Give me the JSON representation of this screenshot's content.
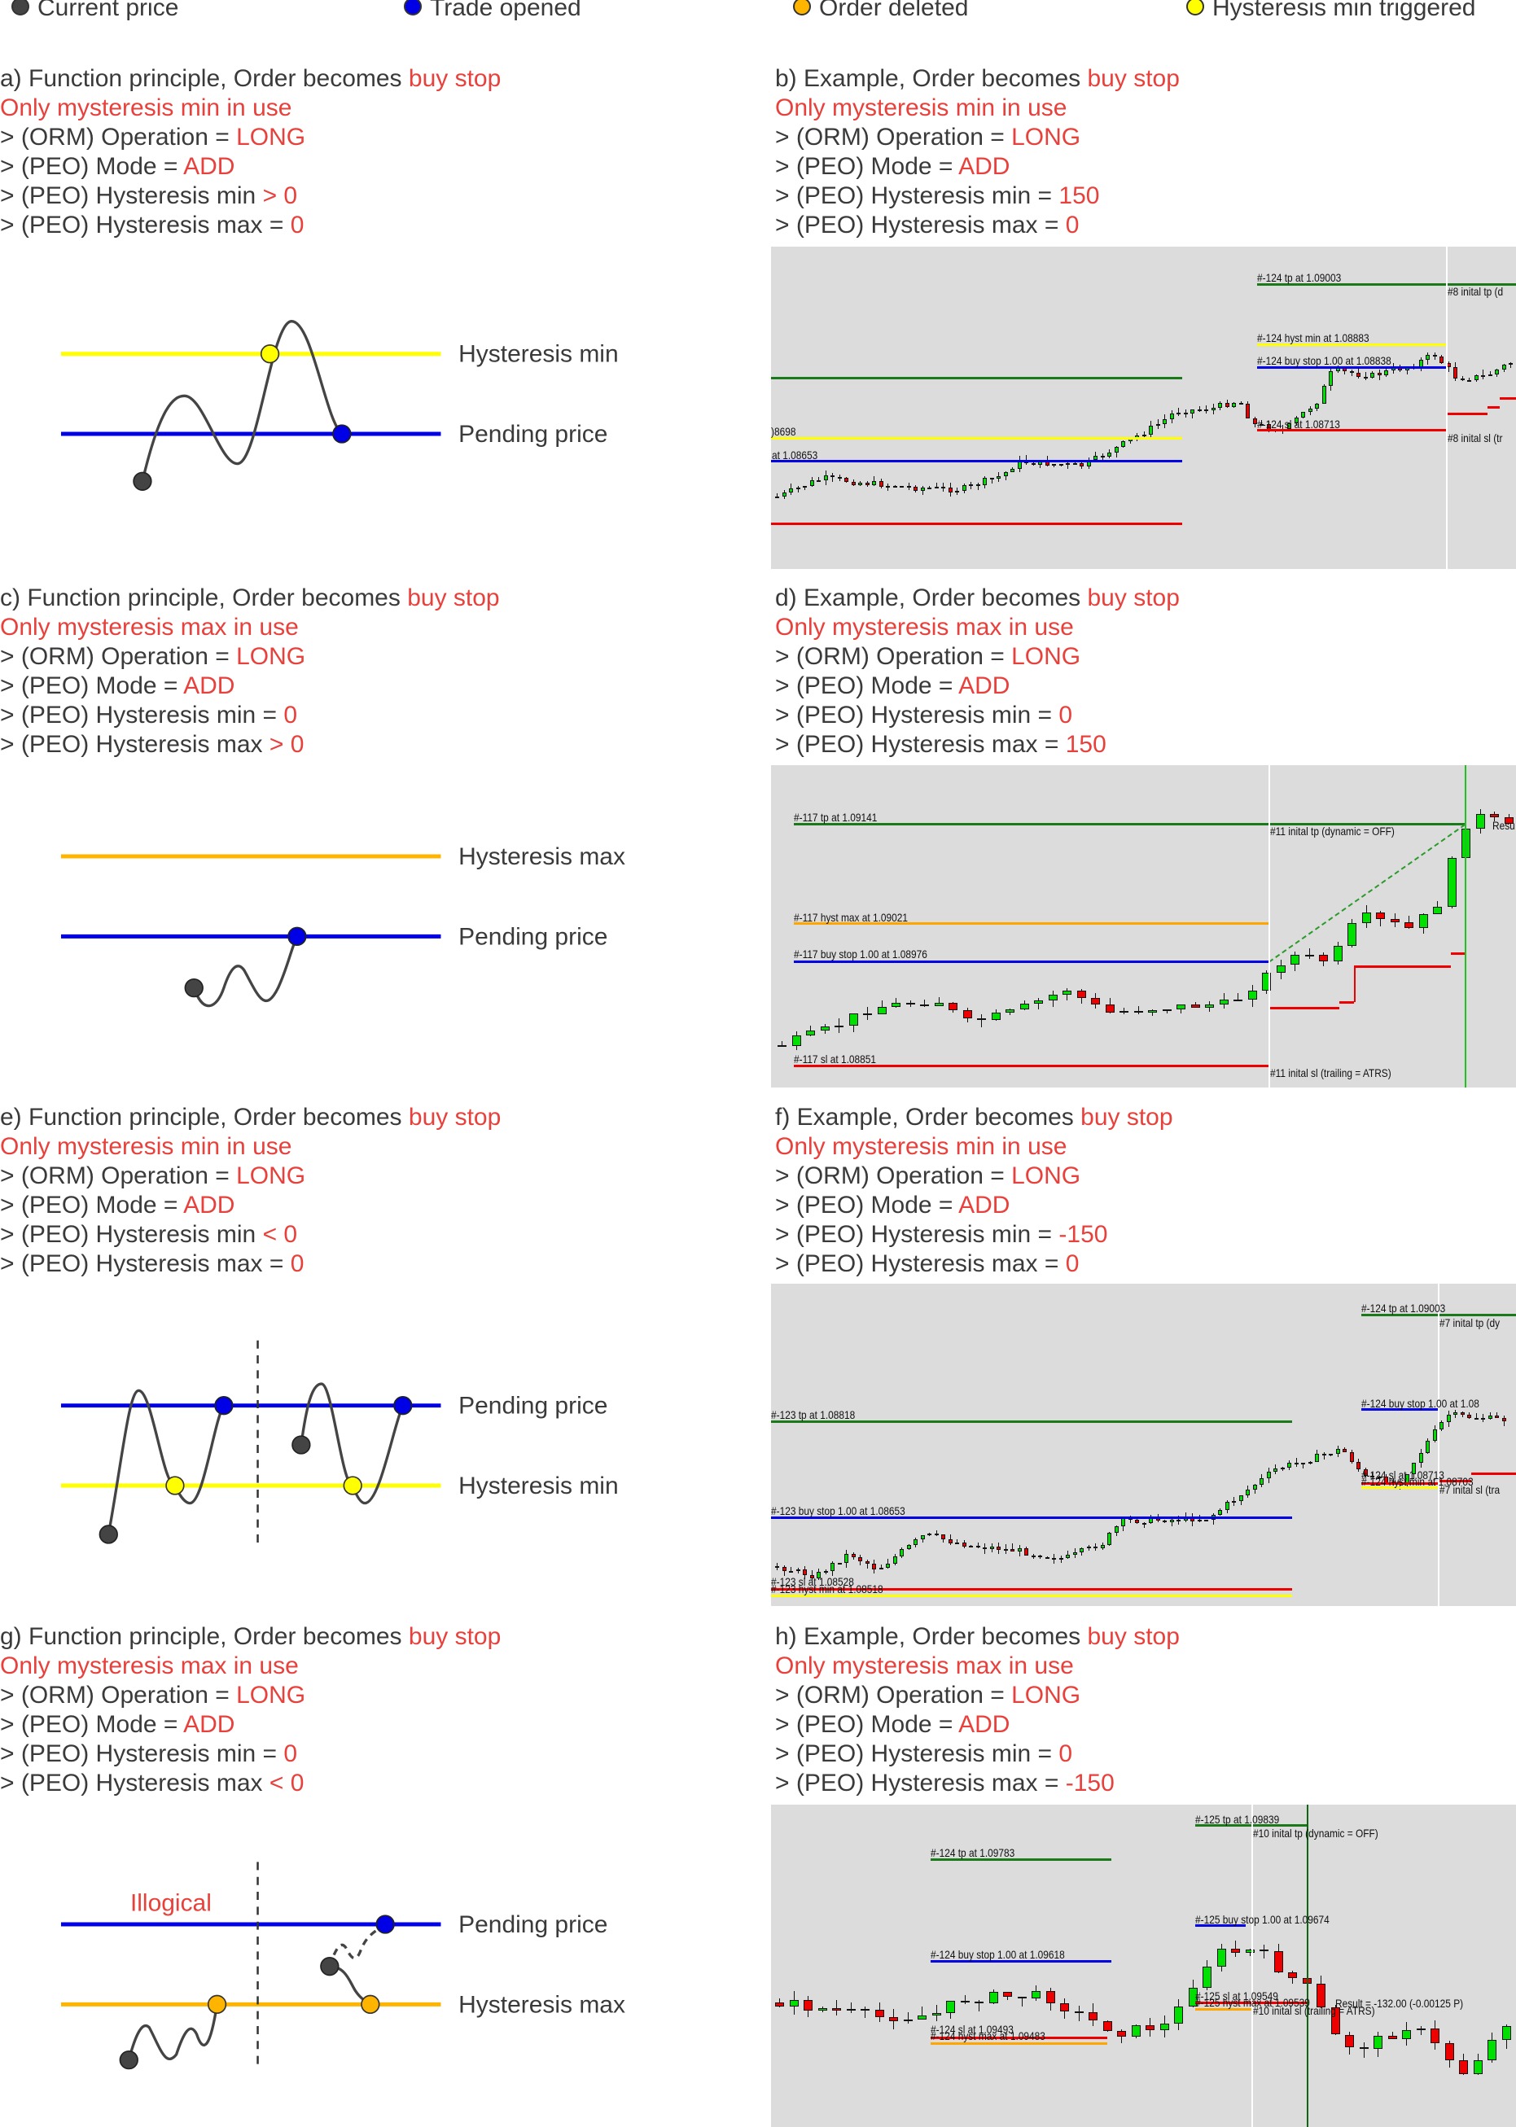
{
  "legend": [
    {
      "label": "Current price",
      "color": "#444444"
    },
    {
      "label": "Trade opened",
      "color": "#0000e6"
    },
    {
      "label": "Order deleted",
      "color": "#ffb400"
    },
    {
      "label": "Hysteresis min triggered",
      "color": "#ffff00"
    }
  ],
  "colors": {
    "accent_red": "#e8413c",
    "candle_up": "#00e000",
    "candle_down": "#ee0000",
    "chart_bg": "#dcdcdc"
  },
  "sections": [
    {
      "title": "a) Function principle, Order becomes ",
      "title_hl": "buy stop",
      "subtitle": "Only mysteresis min in use",
      "lines": [
        {
          "label": "> (ORM) Operation = ",
          "value": "LONG"
        },
        {
          "label": "> (PEO) Mode = ",
          "value": "ADD"
        },
        {
          "label": "> (PEO) Hysteresis min ",
          "value": "> 0"
        },
        {
          "label": "> (PEO) Hysteresis max = ",
          "value": "0"
        }
      ]
    },
    {
      "title": "b) Example, Order becomes ",
      "title_hl": "buy stop",
      "subtitle": "Only mysteresis min in use",
      "lines": [
        {
          "label": "> (ORM) Operation = ",
          "value": "LONG"
        },
        {
          "label": "> (PEO) Mode = ",
          "value": "ADD"
        },
        {
          "label": "> (PEO) Hysteresis min = ",
          "value": "150"
        },
        {
          "label": "> (PEO) Hysteresis max = ",
          "value": "0"
        }
      ]
    },
    {
      "title": "c) Function principle, Order becomes ",
      "title_hl": "buy stop",
      "subtitle": "Only mysteresis max in use",
      "lines": [
        {
          "label": "> (ORM) Operation = ",
          "value": "LONG"
        },
        {
          "label": "> (PEO) Mode = ",
          "value": "ADD"
        },
        {
          "label": "> (PEO) Hysteresis min = ",
          "value": "0"
        },
        {
          "label": "> (PEO) Hysteresis max ",
          "value": "> 0"
        }
      ]
    },
    {
      "title": "d) Example, Order becomes ",
      "title_hl": "buy stop",
      "subtitle": "Only mysteresis max in use",
      "lines": [
        {
          "label": "> (ORM) Operation = ",
          "value": "LONG"
        },
        {
          "label": "> (PEO) Mode = ",
          "value": "ADD"
        },
        {
          "label": "> (PEO) Hysteresis min = ",
          "value": "0"
        },
        {
          "label": "> (PEO) Hysteresis max = ",
          "value": "150"
        }
      ]
    },
    {
      "title": "e) Function principle, Order becomes ",
      "title_hl": "buy stop",
      "subtitle": "Only mysteresis min in use",
      "lines": [
        {
          "label": "> (ORM) Operation = ",
          "value": "LONG"
        },
        {
          "label": "> (PEO) Mode = ",
          "value": "ADD"
        },
        {
          "label": "> (PEO) Hysteresis min ",
          "value": "< 0"
        },
        {
          "label": "> (PEO) Hysteresis max = ",
          "value": "0"
        }
      ]
    },
    {
      "title": "f) Example, Order becomes ",
      "title_hl": "buy stop",
      "subtitle": "Only mysteresis min in use",
      "lines": [
        {
          "label": "> (ORM) Operation = ",
          "value": "LONG"
        },
        {
          "label": "> (PEO) Mode = ",
          "value": "ADD"
        },
        {
          "label": "> (PEO) Hysteresis min = ",
          "value": "-150"
        },
        {
          "label": "> (PEO) Hysteresis max = ",
          "value": "0"
        }
      ]
    },
    {
      "title": "g) Function principle, Order becomes ",
      "title_hl": "buy stop",
      "subtitle": "Only mysteresis max in use",
      "lines": [
        {
          "label": "> (ORM) Operation = ",
          "value": "LONG"
        },
        {
          "label": "> (PEO) Mode = ",
          "value": "ADD"
        },
        {
          "label": "> (PEO) Hysteresis min = ",
          "value": "0"
        },
        {
          "label": "> (PEO) Hysteresis max ",
          "value": "< 0"
        }
      ]
    },
    {
      "title": "h) Example, Order becomes ",
      "title_hl": "buy stop",
      "subtitle": "Only mysteresis max in use",
      "lines": [
        {
          "label": "> (ORM) Operation = ",
          "value": "LONG"
        },
        {
          "label": "> (PEO) Mode = ",
          "value": "ADD"
        },
        {
          "label": "> (PEO) Hysteresis min = ",
          "value": "0"
        },
        {
          "label": "> (PEO) Hysteresis max = ",
          "value": "-150"
        }
      ]
    }
  ],
  "diagrams": {
    "a": {
      "upper": "Hysteresis min",
      "lower": "Pending price"
    },
    "c": {
      "upper": "Hysteresis max",
      "lower": "Pending price"
    },
    "e": {
      "upper": "Pending price",
      "lower": "Hysteresis min"
    },
    "g": {
      "upper": "Pending price",
      "lower": "Hysteresis max",
      "note": "Illogical"
    }
  },
  "charts": {
    "b": [
      "#-124 tp at 1.09003",
      "#8 inital tp (d",
      "#-124 hyst min at 1.08883",
      "#-124 buy stop 1.00 at 1.08838",
      "#-124 sl at 1.08713",
      "#8 inital sl (tr",
      ")8698",
      "at 1.08653"
    ],
    "d": [
      "#-117 tp at 1.09141",
      "#11 inital tp (dynamic = OFF)",
      "#-117 hyst max at 1.09021",
      "#-117 buy stop 1.00 at 1.08976",
      "#-117 sl at 1.08851",
      "#11 inital sl (trailing = ATRS)",
      "Resu"
    ],
    "f": [
      "#-124 tp at 1.09003",
      "#7 inital tp (dy",
      "#-124 buy stop 1.00 at 1.08",
      "#-123 tp at 1.08818",
      "#-123 buy stop 1.00 at 1.08653",
      "#-123 sl at 1.08528",
      "#-123 hyst min at 1.08518",
      "#-124 sl at 1.08713",
      "#-124 hyst min at 1.08703",
      "#7 inital sl (tra"
    ],
    "h": [
      "#-125 tp at 1.09839",
      "#10 inital tp (dynamic = OFF)",
      "#-124 tp at 1.09783",
      "#-125 buy stop 1.00 at 1.09674",
      "#-124 buy stop 1.00 at 1.09618",
      "#-125 sl at 1.09549",
      "#-125 hyst max at 1.09539",
      "#10 inital sl (trailing = ATRS)",
      "Result = -132.00 (-0.00125 P)",
      "#-124 sl at 1.09493",
      "#-124 hyst max at 1.09483"
    ]
  }
}
